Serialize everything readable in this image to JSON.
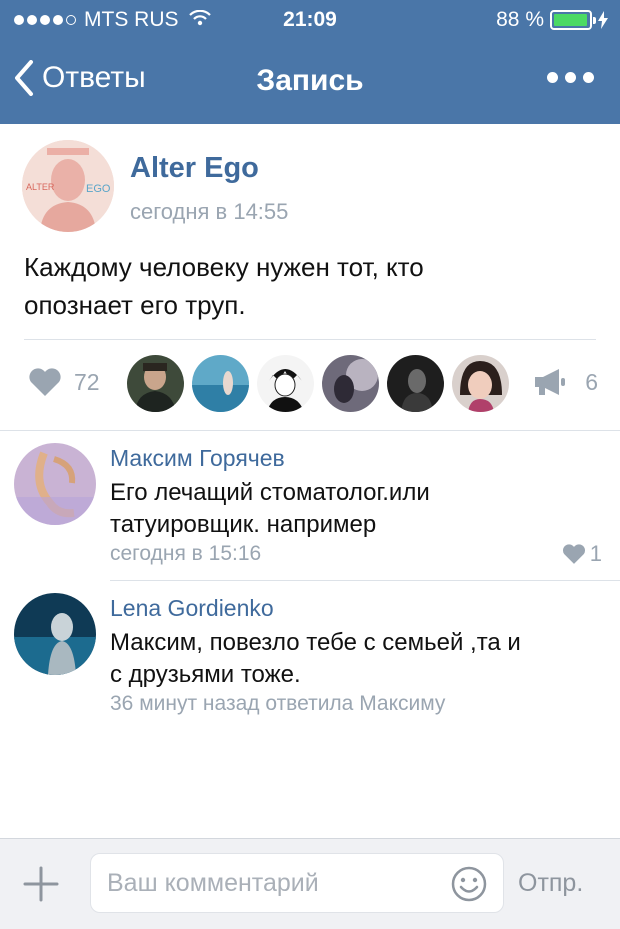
{
  "status_bar": {
    "carrier": "MTS RUS",
    "time": "21:09",
    "battery": "88 %",
    "battery_level": 0.88
  },
  "nav": {
    "back_label": "Ответы",
    "title": "Запись"
  },
  "post": {
    "author": "Alter Ego",
    "time": "сегодня в 14:55",
    "text_line1": "Каждому человеку нужен тот, кто",
    "text_line2": "опознает его труп.",
    "avatar_text_top": "ALTER",
    "avatar_text_right": "EGO",
    "likes": "72",
    "shares": "6"
  },
  "comments": [
    {
      "author": "Максим Горячев",
      "text_line1": "Его лечащий стоматолог.или",
      "text_line2": "татуировщик. например",
      "time": "сегодня в 15:16",
      "likes": "1"
    },
    {
      "author": "Lena Gordienko",
      "text_line1": "Максим, повезло тебе с семьей ,та и",
      "text_line2": "с друзьями тоже.",
      "meta": "36 минут назад ответила Максиму"
    }
  ],
  "composer": {
    "placeholder": "Ваш комментарий",
    "send_label": "Отпр."
  },
  "colors": {
    "header_bg": "#4a76a8",
    "link": "#3f6a9c",
    "muted": "#9aa5b1",
    "battery": "#4cd964"
  }
}
